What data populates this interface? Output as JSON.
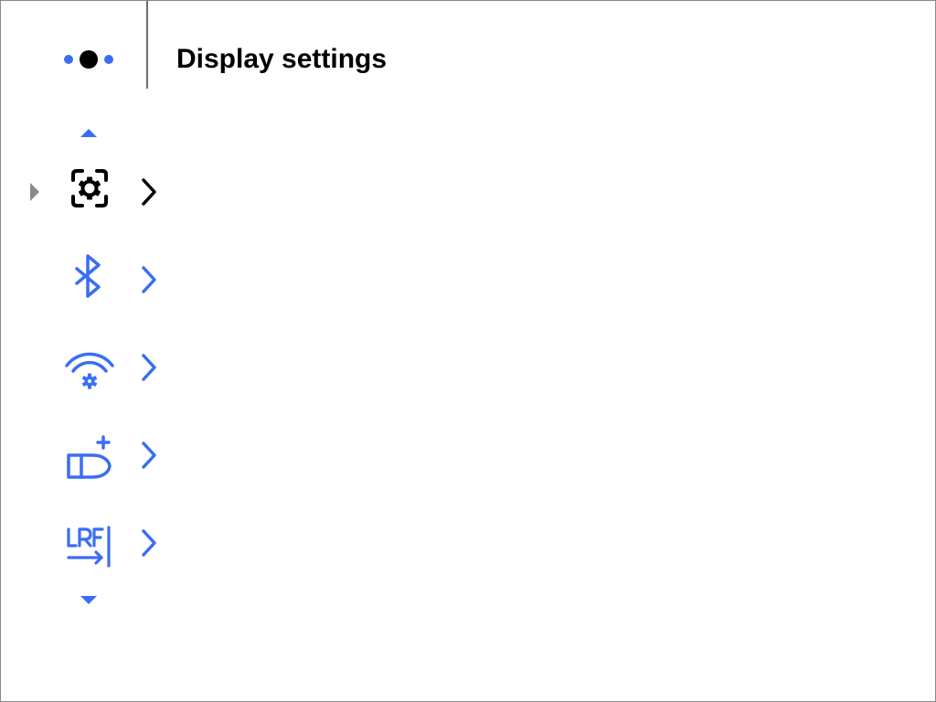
{
  "header": {
    "title": "Display settings",
    "page_indicator_icon": "three-dots-page-indicator-icon"
  },
  "menu": {
    "items": [
      {
        "icon": "general-settings-icon",
        "selected": true
      },
      {
        "icon": "bluetooth-icon",
        "selected": false
      },
      {
        "icon": "wifi-settings-icon",
        "selected": false
      },
      {
        "icon": "ballistic-profile-icon",
        "selected": false
      },
      {
        "icon": "lrf-icon",
        "selected": false
      }
    ],
    "scroll_up_icon": "scroll-up-arrow-icon",
    "scroll_down_icon": "scroll-down-arrow-icon"
  },
  "colors": {
    "accent": "#3a6ef2",
    "selected": "#000000",
    "pointer": "#8a8a8a",
    "border": "#8a8a8a",
    "background": "#ffffff"
  }
}
